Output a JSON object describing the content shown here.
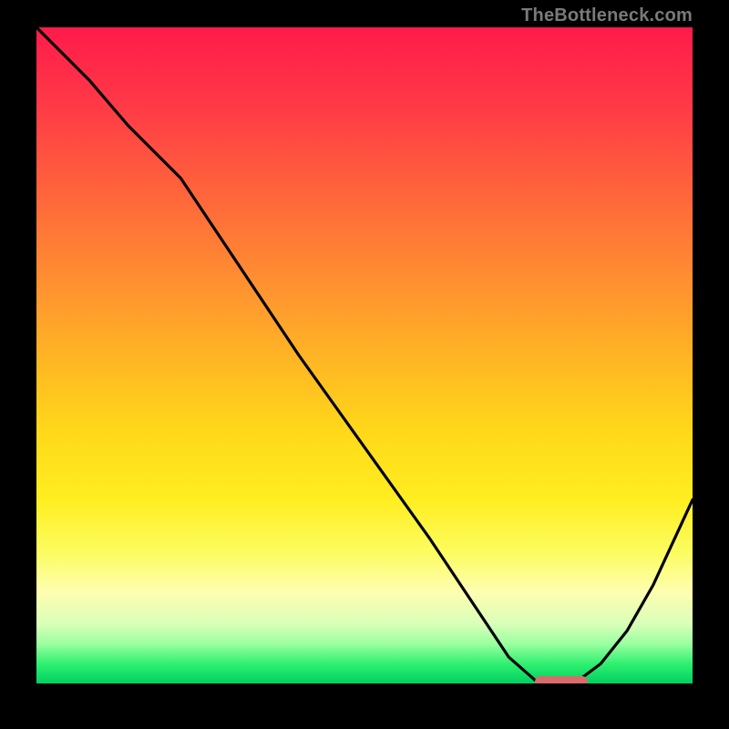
{
  "attribution": "TheBottleneck.com",
  "colors": {
    "background": "#000000",
    "gradient_top": "#ff1a4a",
    "gradient_bottom": "#00d060",
    "curve_stroke": "#000000",
    "marker": "#d86c6c",
    "attribution_text": "#7a7a7a"
  },
  "chart_data": {
    "type": "line",
    "title": "",
    "xlabel": "",
    "ylabel": "",
    "xlim": [
      0,
      100
    ],
    "ylim": [
      0,
      100
    ],
    "grid": false,
    "legend": false,
    "series": [
      {
        "name": "bottleneck-curve",
        "x": [
          0,
          8,
          14,
          22,
          28,
          40,
          50,
          60,
          68,
          72,
          76,
          80,
          82,
          86,
          90,
          94,
          100
        ],
        "values": [
          100,
          92,
          85,
          77,
          68,
          50,
          36,
          22,
          10,
          4,
          0.5,
          0,
          0,
          3,
          8,
          15,
          28
        ]
      }
    ],
    "marker": {
      "name": "sweet-spot",
      "x_start": 76,
      "x_end": 84,
      "y": 0
    },
    "annotations": []
  }
}
